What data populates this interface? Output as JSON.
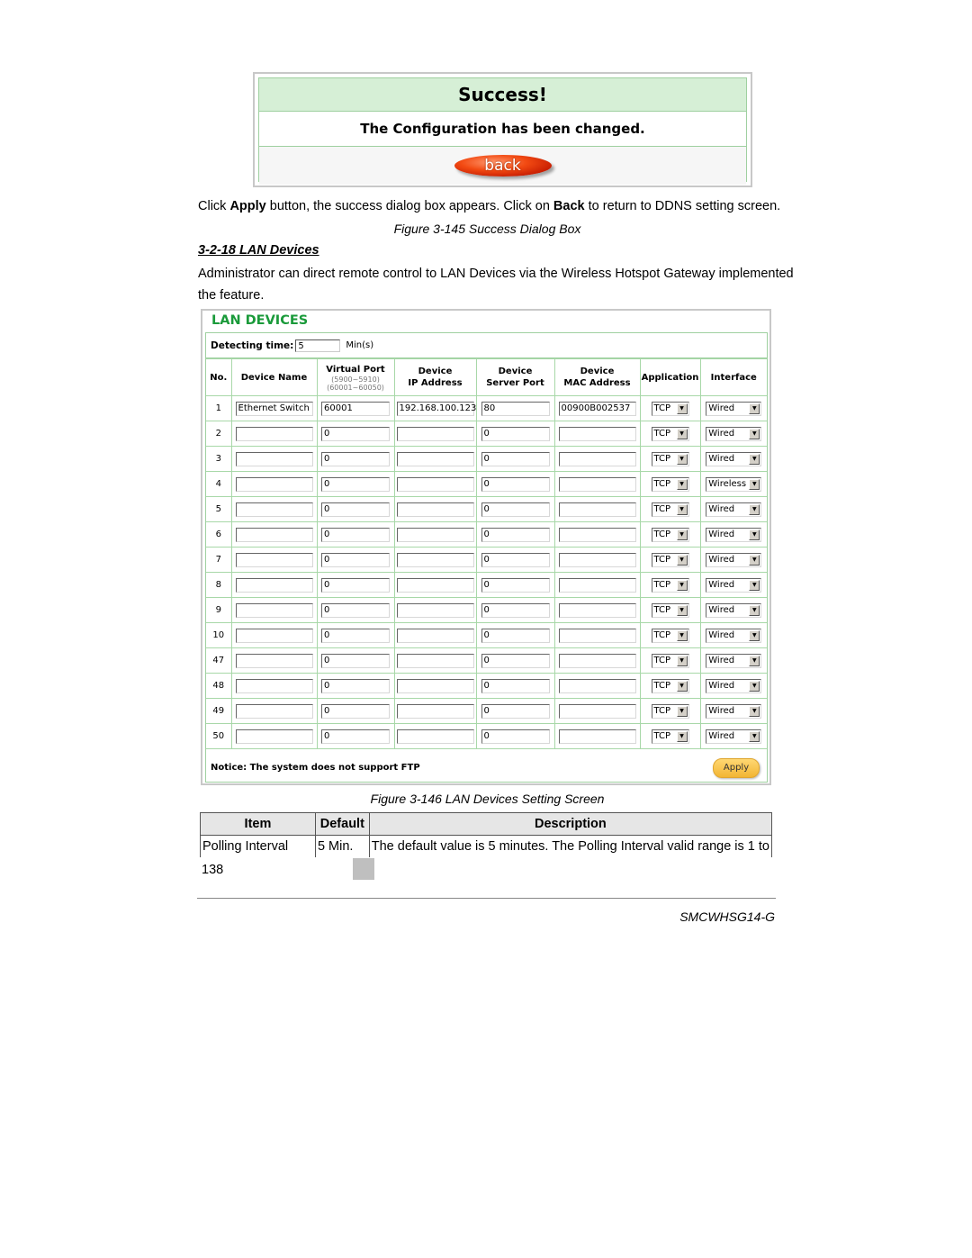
{
  "success_dialog": {
    "title": "Success!",
    "message": "The Configuration has been changed.",
    "back_label": "back"
  },
  "paragraph1": {
    "t1": "Click ",
    "b1": "Apply",
    "t2": " button, the success dialog box appears. Click on ",
    "b2": "Back",
    "t3": " to return to DDNS setting screen."
  },
  "figure145_caption": "Figure 3-145 Success Dialog Box",
  "section_heading": "3-2-18 LAN Devices",
  "paragraph2_line1": "Administrator can direct remote control to LAN Devices via the Wireless Hotspot Gateway implemented",
  "paragraph2_line2": "the feature.",
  "lan_devices": {
    "title": "LAN DEVICES",
    "detecting_time_label": "Detecting time:",
    "detecting_time_value": "5",
    "detecting_time_unit": "Min(s)",
    "columns": {
      "no": "No.",
      "device_name": "Device Name",
      "virtual_port": "Virtual Port",
      "virtual_port_range1": "(5900~5910)",
      "virtual_port_range2": "(60001~60050)",
      "ip_l1": "Device",
      "ip_l2": "IP Address",
      "port_l1": "Device",
      "port_l2": "Server Port",
      "mac_l1": "Device",
      "mac_l2": "MAC Address",
      "application": "Application",
      "interface": "Interface"
    },
    "rows": [
      {
        "no": "1",
        "name": "Ethernet Switch",
        "vport": "60001",
        "ip": "192.168.100.123",
        "sport": "80",
        "mac": "00900B002537",
        "app": "TCP",
        "iface": "Wired"
      },
      {
        "no": "2",
        "name": "",
        "vport": "0",
        "ip": "",
        "sport": "0",
        "mac": "",
        "app": "TCP",
        "iface": "Wired"
      },
      {
        "no": "3",
        "name": "",
        "vport": "0",
        "ip": "",
        "sport": "0",
        "mac": "",
        "app": "TCP",
        "iface": "Wired"
      },
      {
        "no": "4",
        "name": "",
        "vport": "0",
        "ip": "",
        "sport": "0",
        "mac": "",
        "app": "TCP",
        "iface": "Wireless"
      },
      {
        "no": "5",
        "name": "",
        "vport": "0",
        "ip": "",
        "sport": "0",
        "mac": "",
        "app": "TCP",
        "iface": "Wired"
      },
      {
        "no": "6",
        "name": "",
        "vport": "0",
        "ip": "",
        "sport": "0",
        "mac": "",
        "app": "TCP",
        "iface": "Wired"
      },
      {
        "no": "7",
        "name": "",
        "vport": "0",
        "ip": "",
        "sport": "0",
        "mac": "",
        "app": "TCP",
        "iface": "Wired"
      },
      {
        "no": "8",
        "name": "",
        "vport": "0",
        "ip": "",
        "sport": "0",
        "mac": "",
        "app": "TCP",
        "iface": "Wired"
      },
      {
        "no": "9",
        "name": "",
        "vport": "0",
        "ip": "",
        "sport": "0",
        "mac": "",
        "app": "TCP",
        "iface": "Wired"
      },
      {
        "no": "10",
        "name": "",
        "vport": "0",
        "ip": "",
        "sport": "0",
        "mac": "",
        "app": "TCP",
        "iface": "Wired"
      },
      {
        "no": "47",
        "name": "",
        "vport": "0",
        "ip": "",
        "sport": "0",
        "mac": "",
        "app": "TCP",
        "iface": "Wired"
      },
      {
        "no": "48",
        "name": "",
        "vport": "0",
        "ip": "",
        "sport": "0",
        "mac": "",
        "app": "TCP",
        "iface": "Wired"
      },
      {
        "no": "49",
        "name": "",
        "vport": "0",
        "ip": "",
        "sport": "0",
        "mac": "",
        "app": "TCP",
        "iface": "Wired"
      },
      {
        "no": "50",
        "name": "",
        "vport": "0",
        "ip": "",
        "sport": "0",
        "mac": "",
        "app": "TCP",
        "iface": "Wired"
      }
    ],
    "notice": "Notice: The system does not support FTP",
    "apply_label": "Apply",
    "dropdown_arrow_icon": "▼"
  },
  "figure146_caption": "Figure 3-146 LAN Devices Setting Screen",
  "description_table": {
    "headers": [
      "Item",
      "Default",
      "Description"
    ],
    "rows": [
      [
        "Polling Interval",
        "5 Min.",
        "The default value is 5 minutes. The Polling Interval valid range is 1 to"
      ]
    ]
  },
  "page_number": "138",
  "footer_model": "SMCWHSG14-G"
}
